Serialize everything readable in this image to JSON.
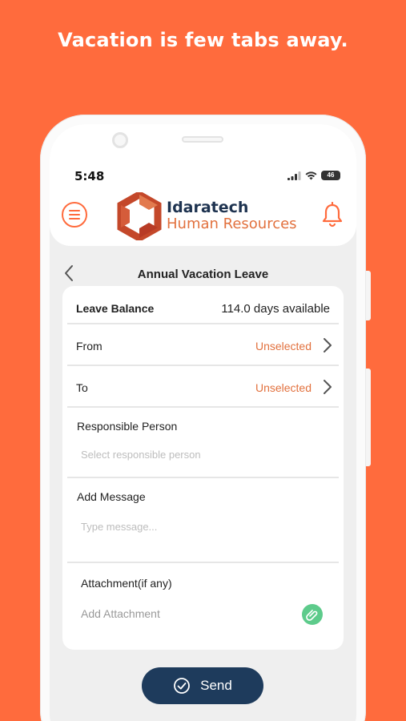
{
  "headline": "Vacation is few tabs away.",
  "status_bar": {
    "time": "5:48",
    "battery": "46"
  },
  "header": {
    "brand_name": "Idaratech",
    "brand_sub": "Human Resources",
    "accent_color": "#FF6B3D",
    "brand_color": "#1E3350",
    "icons": [
      "menu-icon",
      "logo-icon",
      "bell-icon"
    ]
  },
  "nav": {
    "title": "Annual Vacation Leave"
  },
  "form": {
    "leave_balance_label": "Leave Balance",
    "leave_balance_value": "114.0 days available",
    "from_label": "From",
    "from_value": "Unselected",
    "to_label": "To",
    "to_value": "Unselected",
    "responsible_label": "Responsible Person",
    "responsible_placeholder": "Select responsible person",
    "message_label": "Add Message",
    "message_placeholder": "Type message...",
    "attachment_label": "Attachment(if any)",
    "attachment_placeholder": "Add Attachment"
  },
  "send_button": {
    "label": "Send",
    "color": "#1E3B5C"
  }
}
